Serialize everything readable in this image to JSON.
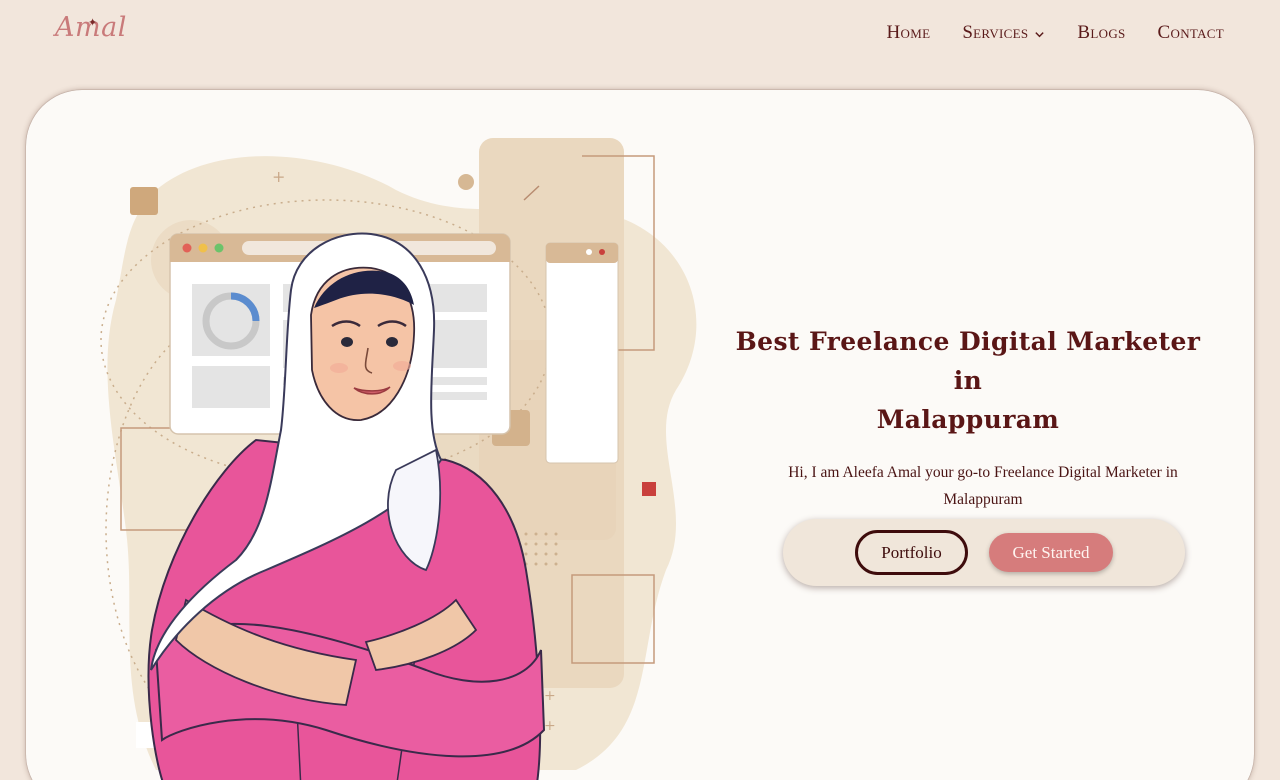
{
  "header": {
    "logo_text": "Amal",
    "nav": {
      "home": "Home",
      "services": "Services",
      "blogs": "Blogs",
      "contact": "Contact"
    }
  },
  "hero": {
    "title_line1": "Best Freelance Digital Marketer in",
    "title_line2": "Malappuram",
    "subtitle_line1": "Hi, I am Aleefa Amal your go-to Freelance Digital Marketer in",
    "subtitle_line2": "Malappuram",
    "portfolio_label": "Portfolio",
    "get_started_label": "Get Started"
  },
  "colors": {
    "page_bg": "#f2e6dc",
    "card_bg": "#fcfaf7",
    "text_maroon": "#5a1616",
    "accent_pink": "#d67c7c",
    "shirt_pink": "#e8559a"
  },
  "icons": {
    "nav_dropdown": "chevron-down-icon",
    "logo_mark": "sparkle-icon"
  }
}
